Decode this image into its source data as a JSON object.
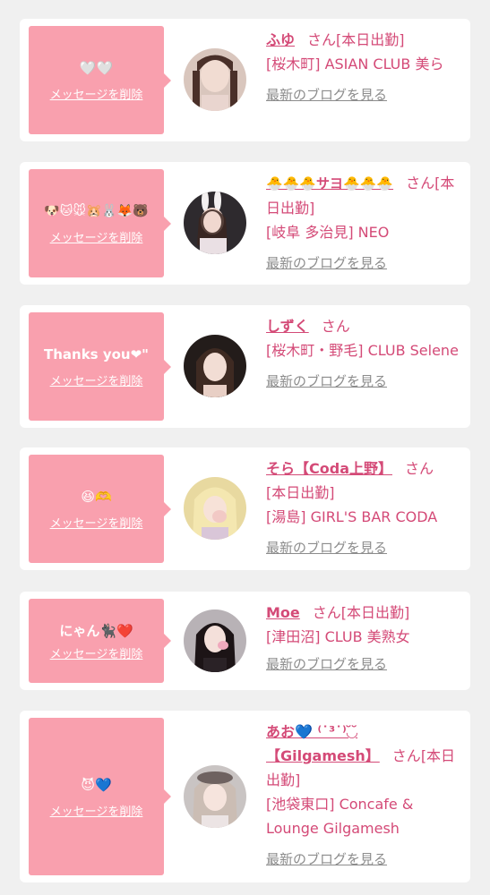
{
  "accent_color": "#d44a77",
  "bubble_color": "#f9a0ae",
  "delete_label": "メッセージを削除",
  "blog_label": "最新のブログを見る",
  "entries": [
    {
      "message": "🤍🤍",
      "name": "ふゆ",
      "honorific": "さん",
      "status": "[本日出勤]",
      "shop": "[桜木町] ASIAN CLUB 美ら"
    },
    {
      "message": "🐶🐱🐭🐹🐰🦊🐻",
      "name": "🐣🐣🐣サヨ🐣🐣🐣",
      "honorific": "さん",
      "status": "[本日出勤]",
      "shop": "[岐阜 多治見] NEO"
    },
    {
      "message": "Thanks you❤︎\"",
      "name": "しずく",
      "honorific": "さん",
      "status": "",
      "shop": "[桜木町・野毛] CLUB Selene"
    },
    {
      "message": "😆🫶",
      "name": "そら【Coda上野】",
      "honorific": "さん",
      "status": "[本日出勤]",
      "shop": "[湯島] GIRL'S BAR CODA"
    },
    {
      "message": "にゃん🐈‍⬛❤️",
      "name": "Moe",
      "honorific": "さん",
      "status": "[本日出勤]",
      "shop": "[津田沼] CLUB 美熟女"
    },
    {
      "message": "😈💙",
      "name": "あお💙 ⁽˙³˙⁾◟̆◞̆ 【Gilgamesh】",
      "honorific": "さん",
      "status": "[本日出勤]",
      "shop": "[池袋東口] Concafe & Lounge Gilgamesh"
    }
  ]
}
